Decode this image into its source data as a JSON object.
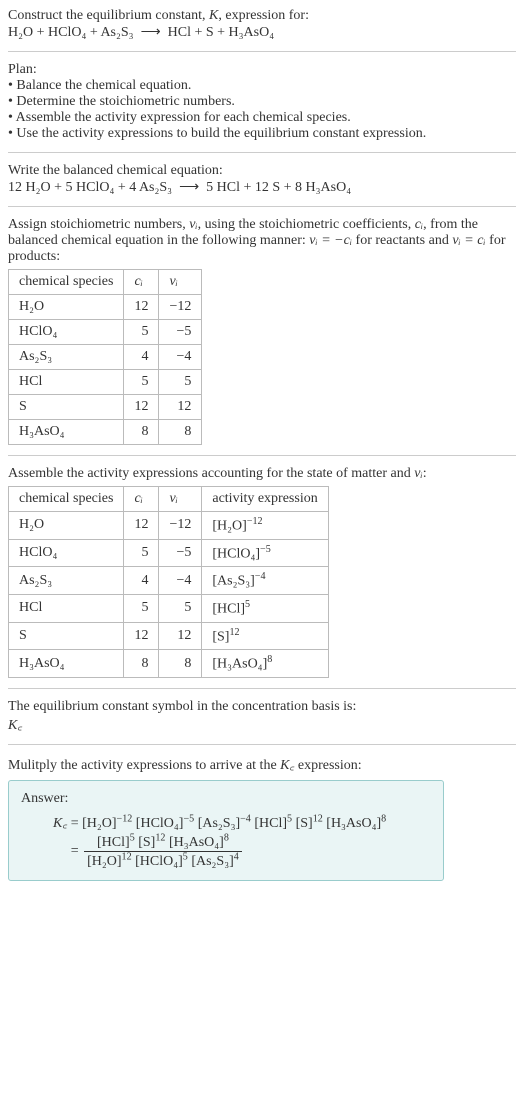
{
  "intro": {
    "line1_pre": "Construct the equilibrium constant, ",
    "line1_k": "K",
    "line1_post": ", expression for:",
    "eq_lhs": "H₂O + HClO₄ + As₂S₃",
    "arrow": "⟶",
    "eq_rhs": "HCl + S + H₃AsO₄"
  },
  "plan": {
    "title": "Plan:",
    "b1": "• Balance the chemical equation.",
    "b2": "• Determine the stoichiometric numbers.",
    "b3": "• Assemble the activity expression for each chemical species.",
    "b4": "• Use the activity expressions to build the equilibrium constant expression."
  },
  "balanced": {
    "title": "Write the balanced chemical equation:",
    "lhs": "12 H₂O + 5 HClO₄ + 4 As₂S₃",
    "arrow": "⟶",
    "rhs": "5 HCl + 12 S + 8 H₃AsO₄"
  },
  "stoich": {
    "intro_a": "Assign stoichiometric numbers, ",
    "nu": "νᵢ",
    "intro_b": ", using the stoichiometric coefficients, ",
    "ci": "cᵢ",
    "intro_c": ", from the balanced chemical equation in the following manner: ",
    "rule1": "νᵢ = −cᵢ",
    "intro_d": " for reactants and ",
    "rule2": "νᵢ = cᵢ",
    "intro_e": " for products:",
    "headers": {
      "h1": "chemical species",
      "h2": "cᵢ",
      "h3": "νᵢ"
    },
    "rows": [
      {
        "sp": "H₂O",
        "c": "12",
        "v": "−12"
      },
      {
        "sp": "HClO₄",
        "c": "5",
        "v": "−5"
      },
      {
        "sp": "As₂S₃",
        "c": "4",
        "v": "−4"
      },
      {
        "sp": "HCl",
        "c": "5",
        "v": "5"
      },
      {
        "sp": "S",
        "c": "12",
        "v": "12"
      },
      {
        "sp": "H₃AsO₄",
        "c": "8",
        "v": "8"
      }
    ]
  },
  "activity": {
    "intro_a": "Assemble the activity expressions accounting for the state of matter and ",
    "nu": "νᵢ",
    "intro_b": ":",
    "headers": {
      "h1": "chemical species",
      "h2": "cᵢ",
      "h3": "νᵢ",
      "h4": "activity expression"
    },
    "rows": [
      {
        "sp": "H₂O",
        "c": "12",
        "v": "−12",
        "base": "[H₂O]",
        "exp": "−12"
      },
      {
        "sp": "HClO₄",
        "c": "5",
        "v": "−5",
        "base": "[HClO₄]",
        "exp": "−5"
      },
      {
        "sp": "As₂S₃",
        "c": "4",
        "v": "−4",
        "base": "[As₂S₃]",
        "exp": "−4"
      },
      {
        "sp": "HCl",
        "c": "5",
        "v": "5",
        "base": "[HCl]",
        "exp": "5"
      },
      {
        "sp": "S",
        "c": "12",
        "v": "12",
        "base": "[S]",
        "exp": "12"
      },
      {
        "sp": "H₃AsO₄",
        "c": "8",
        "v": "8",
        "base": "[H₃AsO₄]",
        "exp": "8"
      }
    ]
  },
  "kc_symbol": {
    "line1": "The equilibrium constant symbol in the concentration basis is:",
    "sym": "K꜀"
  },
  "multiply": {
    "line_a": "Mulitply the activity expressions to arrive at the ",
    "kc": "K꜀",
    "line_b": " expression:"
  },
  "answer": {
    "title": "Answer:",
    "kc": "K꜀",
    "eq1_sign": " = ",
    "t1_b": "[H₂O]",
    "t1_e": "−12",
    "t2_b": "[HClO₄]",
    "t2_e": "−5",
    "t3_b": "[As₂S₃]",
    "t3_e": "−4",
    "t4_b": "[HCl]",
    "t4_e": "5",
    "t5_b": "[S]",
    "t5_e": "12",
    "t6_b": "[H₃AsO₄]",
    "t6_e": "8",
    "eq2_sign": " = ",
    "num1_b": "[HCl]",
    "num1_e": "5",
    "num2_b": "[S]",
    "num2_e": "12",
    "num3_b": "[H₃AsO₄]",
    "num3_e": "8",
    "den1_b": "[H₂O]",
    "den1_e": "12",
    "den2_b": "[HClO₄]",
    "den2_e": "5",
    "den3_b": "[As₂S₃]",
    "den3_e": "4"
  }
}
